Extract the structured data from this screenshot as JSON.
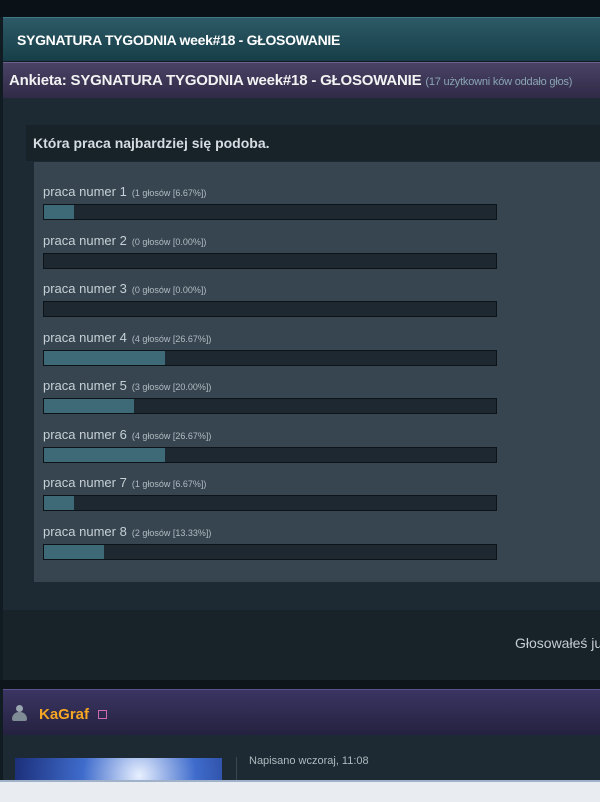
{
  "topic": {
    "title": "SYGNATURA TYGODNIA week#18 - GŁOSOWANIE"
  },
  "poll": {
    "header": "Ankieta: SYGNATURA TYGODNIA week#18 - GŁOSOWANIE",
    "count_text": "(17 użytkowni ków oddało głos)",
    "question": "Która praca najbardziej się podoba.",
    "choices": [
      {
        "label": "praca numer 1",
        "votes_text": "(1 głosów [6.67%])",
        "percent": 6.67
      },
      {
        "label": "praca numer 2",
        "votes_text": "(0 głosów [0.00%])",
        "percent": 0.0
      },
      {
        "label": "praca numer 3",
        "votes_text": "(0 głosów [0.00%])",
        "percent": 0.0
      },
      {
        "label": "praca numer 4",
        "votes_text": "(4 głosów [26.67%])",
        "percent": 26.67
      },
      {
        "label": "praca numer 5",
        "votes_text": "(3 głosów [20.00%])",
        "percent": 20.0
      },
      {
        "label": "praca numer 6",
        "votes_text": "(4 głosów [26.67%])",
        "percent": 26.67
      },
      {
        "label": "praca numer 7",
        "votes_text": "(1 głosów [6.67%])",
        "percent": 6.67
      },
      {
        "label": "praca numer 8",
        "votes_text": "(2 głosów [13.33%])",
        "percent": 13.33
      }
    ],
    "footer_text": "Głosowałeś już"
  },
  "post": {
    "username": "KaGraf",
    "date_text": "Napisano wczoraj, 11:08"
  },
  "colors": {
    "bar_fill": "#3d6a76",
    "username": "#f5a623"
  }
}
